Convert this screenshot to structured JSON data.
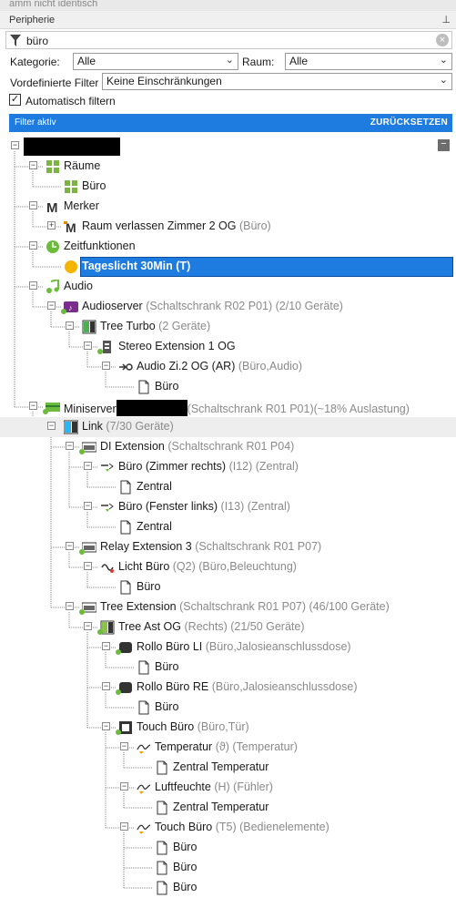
{
  "window": {
    "top_strip_text": "amm nicht identisch",
    "panel_title": "Peripherie",
    "pin_label": "⊥"
  },
  "search": {
    "value": "büro"
  },
  "filters": {
    "category_label": "Kategorie:",
    "category_value": "Alle",
    "room_label": "Raum:",
    "room_value": "Alle",
    "predefined_label": "Vordefinierte Filter",
    "predefined_value": "Keine Einschränkungen",
    "auto_filter_label": "Automatisch filtern",
    "auto_filter_checked": true
  },
  "filter_bar": {
    "active_label": "Filter aktiv",
    "reset_label": "ZURÜCKSETZEN",
    "color": "#1e7be0"
  },
  "tree": [
    {
      "label": "",
      "suffix": "",
      "icon": "redacted-root"
    },
    {
      "label": "Räume",
      "suffix": "",
      "icon": "rooms-icon"
    },
    {
      "label": "Büro",
      "suffix": "",
      "icon": "room-icon"
    },
    {
      "label": "Merker",
      "suffix": "",
      "icon": "merker-icon"
    },
    {
      "label": "Raum verlassen Zimmer 2 OG",
      "suffix": "(Büro)",
      "icon": "merker-item-icon"
    },
    {
      "label": "Zeitfunktionen",
      "suffix": "",
      "icon": "clock-icon"
    },
    {
      "label": "Tageslicht 30Min (T)",
      "suffix": "",
      "icon": "sun-dot-icon",
      "selected": true
    },
    {
      "label": "Audio",
      "suffix": "",
      "icon": "music-note-icon"
    },
    {
      "label": "Audioserver",
      "suffix": "(Schaltschrank R02 P01) (2/10 Geräte)",
      "icon": "audioserver-icon"
    },
    {
      "label": "Tree Turbo",
      "suffix": "(2 Geräte)",
      "icon": "tree-turbo-icon"
    },
    {
      "label": "Stereo Extension 1 OG",
      "suffix": "",
      "icon": "stereo-extension-icon"
    },
    {
      "label": "Audio Zi.2 OG (AR)",
      "suffix": "(Büro,Audio)",
      "icon": "audio-output-icon"
    },
    {
      "label": "Büro",
      "suffix": "",
      "icon": "document-icon"
    },
    {
      "label": "Miniserver",
      "suffix": "(Schaltschrank R01 P01)(~18% Auslastung)",
      "icon": "miniserver-icon"
    },
    {
      "label": "Link",
      "suffix": "(7/30 Geräte)",
      "icon": "link-icon"
    },
    {
      "label": "DI Extension",
      "suffix": "(Schaltschrank R01 P04)",
      "icon": "di-extension-icon"
    },
    {
      "label": "Büro (Zimmer rechts)",
      "suffix": "(I12) (Zentral)",
      "icon": "input-icon"
    },
    {
      "label": "Zentral",
      "suffix": "",
      "icon": "document-icon"
    },
    {
      "label": "Büro (Fenster links)",
      "suffix": "(I13) (Zentral)",
      "icon": "input-icon"
    },
    {
      "label": "Zentral",
      "suffix": "",
      "icon": "document-icon"
    },
    {
      "label": "Relay Extension 3",
      "suffix": "(Schaltschrank R01 P07)",
      "icon": "relay-extension-icon"
    },
    {
      "label": "Licht Büro",
      "suffix": "(Q2) (Büro,Beleuchtung)",
      "icon": "output-icon"
    },
    {
      "label": "Büro",
      "suffix": "",
      "icon": "document-icon"
    },
    {
      "label": "Tree Extension",
      "suffix": "(Schaltschrank R01 P07) (46/100 Geräte)",
      "icon": "tree-extension-icon"
    },
    {
      "label": "Tree Ast OG",
      "suffix": "(Rechts) (21/50 Geräte)",
      "icon": "tree-branch-icon"
    },
    {
      "label": "Rollo Büro LI",
      "suffix": "(Büro,Jalosieanschlussdose)",
      "icon": "blind-actuator-icon"
    },
    {
      "label": "Büro",
      "suffix": "",
      "icon": "document-icon"
    },
    {
      "label": "Rollo Büro RE",
      "suffix": "(Büro,Jalosieanschlussdose)",
      "icon": "blind-actuator-icon"
    },
    {
      "label": "Büro",
      "suffix": "",
      "icon": "document-icon"
    },
    {
      "label": "Touch Büro",
      "suffix": "(Büro,Tür)",
      "icon": "touch-icon"
    },
    {
      "label": "Temperatur",
      "suffix": "(ϑ) (Temperatur)",
      "icon": "analog-input-icon"
    },
    {
      "label": "Zentral Temperatur",
      "suffix": "",
      "icon": "document-icon"
    },
    {
      "label": "Luftfeuchte",
      "suffix": "(H) (Fühler)",
      "icon": "analog-input-icon"
    },
    {
      "label": "Zentral Temperatur",
      "suffix": "",
      "icon": "document-icon"
    },
    {
      "label": "Touch Büro",
      "suffix": "(T5) (Bedienelemente)",
      "icon": "analog-input-icon"
    },
    {
      "label": "Büro",
      "suffix": "",
      "icon": "document-icon"
    },
    {
      "label": "Büro",
      "suffix": "",
      "icon": "document-icon"
    },
    {
      "label": "Büro",
      "suffix": "",
      "icon": "document-icon"
    }
  ]
}
